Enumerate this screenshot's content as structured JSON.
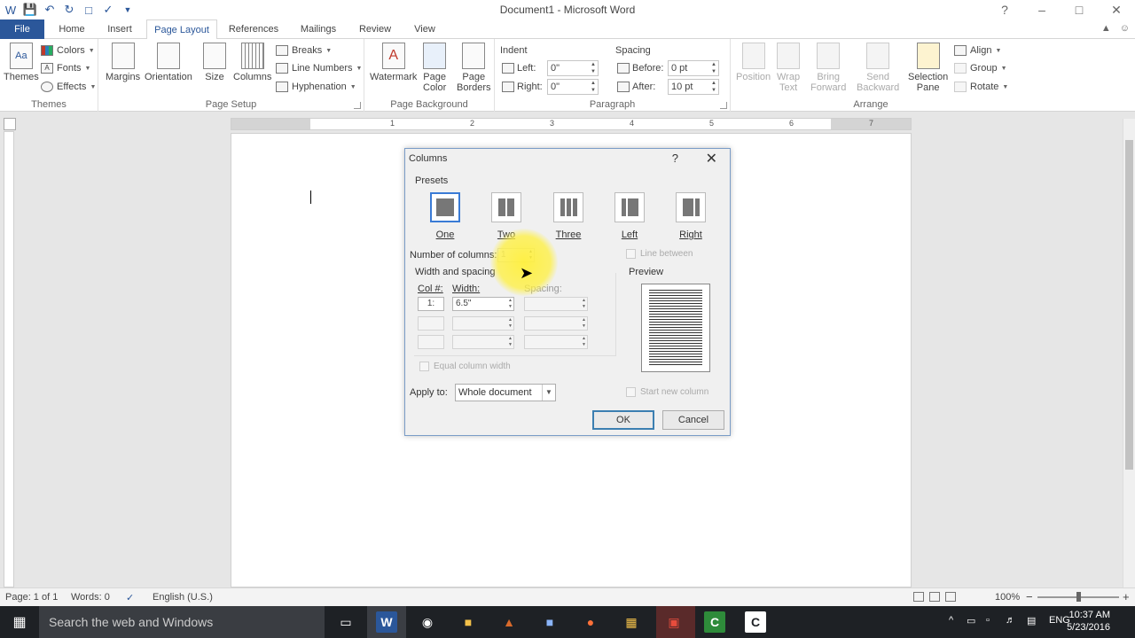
{
  "window": {
    "title": "Document1 - Microsoft Word"
  },
  "qat": {
    "icons": [
      "word-icon",
      "save-icon",
      "undo-icon",
      "redo-icon",
      "new-doc-icon",
      "spelling-icon",
      "customize-icon"
    ]
  },
  "tabs": [
    {
      "label": "File"
    },
    {
      "label": "Home"
    },
    {
      "label": "Insert"
    },
    {
      "label": "Page Layout"
    },
    {
      "label": "References"
    },
    {
      "label": "Mailings"
    },
    {
      "label": "Review"
    },
    {
      "label": "View"
    }
  ],
  "ribbon": {
    "themes": {
      "themes_label": "Themes",
      "colors_label": "Colors",
      "fonts_label": "Fonts",
      "effects_label": "Effects",
      "group_label": "Themes"
    },
    "page_setup": {
      "margins_label": "Margins",
      "orientation_label": "Orientation",
      "size_label": "Size",
      "columns_label": "Columns",
      "breaks_label": "Breaks",
      "line_numbers_label": "Line Numbers",
      "hyphenation_label": "Hyphenation",
      "group_label": "Page Setup"
    },
    "page_background": {
      "watermark_label": "Watermark",
      "page_color_label": "Page\nColor",
      "page_borders_label": "Page\nBorders",
      "group_label": "Page Background"
    },
    "paragraph": {
      "indent_label": "Indent",
      "spacing_label": "Spacing",
      "left_label": "Left:",
      "left_value": "0\"",
      "right_label": "Right:",
      "right_value": "0\"",
      "before_label": "Before:",
      "before_value": "0 pt",
      "after_label": "After:",
      "after_value": "10 pt",
      "group_label": "Paragraph"
    },
    "arrange": {
      "position_label": "Position",
      "wrap_text_label": "Wrap\nText",
      "bring_forward_label": "Bring\nForward",
      "send_backward_label": "Send\nBackward",
      "selection_pane_label": "Selection\nPane",
      "align_label": "Align",
      "group_label_small": "Group",
      "rotate_label": "Rotate",
      "group_label": "Arrange"
    }
  },
  "ruler": {
    "numbers": [
      "1",
      "2",
      "3",
      "4",
      "5",
      "6",
      "7"
    ]
  },
  "dialog": {
    "title": "Columns",
    "help": "?",
    "presets_label": "Presets",
    "presets": [
      {
        "label": "One",
        "cols": 1
      },
      {
        "label": "Two",
        "cols": 2
      },
      {
        "label": "Three",
        "cols": 3
      },
      {
        "label": "Left",
        "cols": 2
      },
      {
        "label": "Right",
        "cols": 2
      }
    ],
    "selected_preset": "One",
    "num_columns_label": "Number of columns:",
    "num_columns_value": "1",
    "line_between_label": "Line between",
    "width_spacing_label": "Width and spacing",
    "preview_label": "Preview",
    "col_label": "Col #:",
    "width_label": "Width:",
    "spacing_label": "Spacing:",
    "rows": [
      {
        "col": "1:",
        "width": "6.5\"",
        "spacing": ""
      },
      {
        "col": "",
        "width": "",
        "spacing": ""
      },
      {
        "col": "",
        "width": "",
        "spacing": ""
      }
    ],
    "equal_width_label": "Equal column width",
    "apply_to_label": "Apply to:",
    "apply_to_value": "Whole document",
    "start_new_column_label": "Start new column",
    "ok_label": "OK",
    "cancel_label": "Cancel"
  },
  "status": {
    "page": "Page: 1 of 1",
    "words": "Words: 0",
    "language": "English (U.S.)",
    "zoom": "100%"
  },
  "taskbar": {
    "search_placeholder": "Search the web and Windows",
    "language": "ENG",
    "time": "10:37 AM",
    "date": "5/23/2016"
  },
  "colors": {
    "accent": "#2b579a",
    "highlight": "#fff03c",
    "taskbar": "#1e2125"
  }
}
